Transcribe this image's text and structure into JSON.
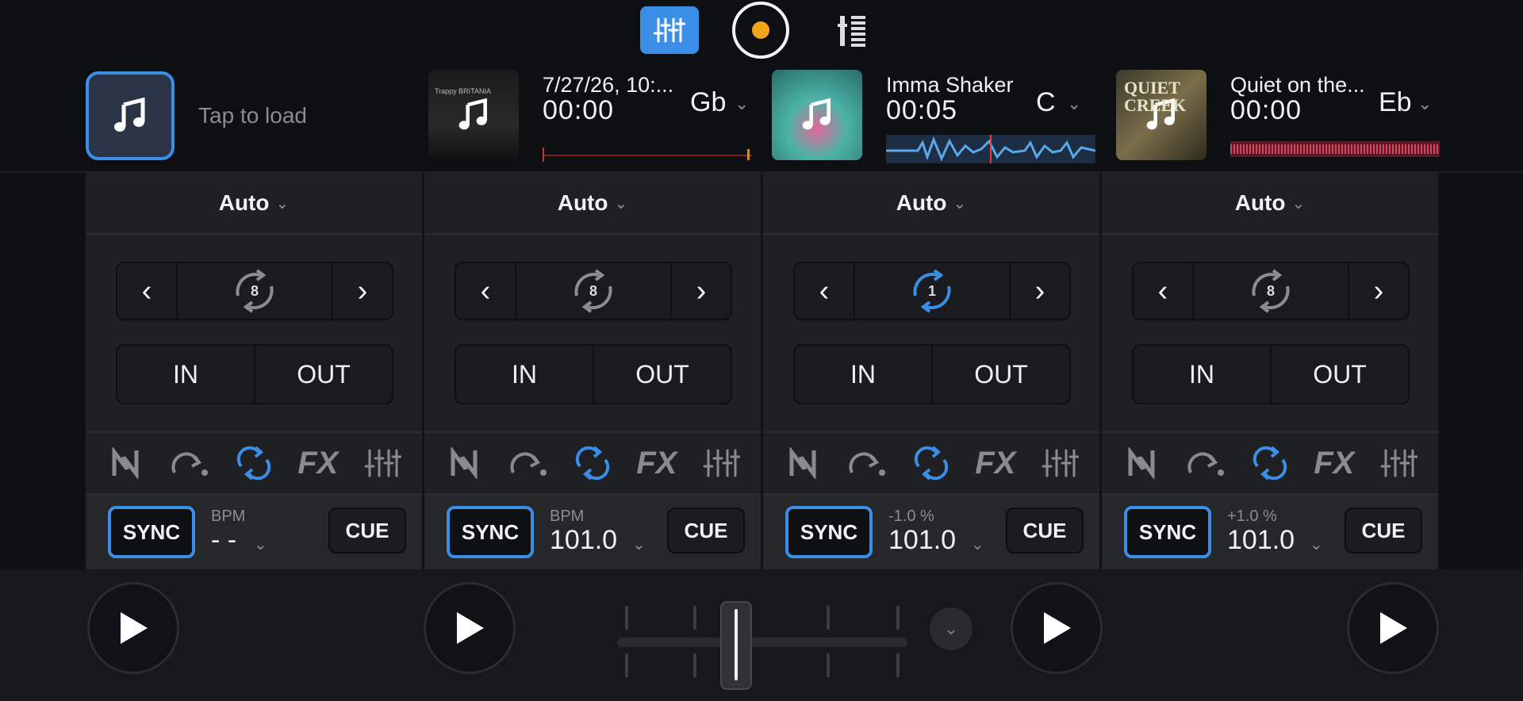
{
  "topbar": {
    "icons": [
      "mixer-icon",
      "record-icon",
      "levels-icon"
    ],
    "accent_color": "#3a8ee6",
    "record_color": "#f3a51a"
  },
  "load": {
    "text": "Tap to load"
  },
  "decks_header": [
    {
      "title": "7/27/26, 10:...",
      "time": "00:00",
      "key": "Gb",
      "waveform_color": "#c9362c"
    },
    {
      "title": "Imma Shaker",
      "time": "00:05",
      "key": "C",
      "waveform_color": "#3a8ee6"
    },
    {
      "title": "Quiet on the...",
      "time": "00:00",
      "key": "Eb",
      "waveform_color": "#d8455f"
    }
  ],
  "art_text": {
    "deck1_lines": "Trappy BRITANIA",
    "deck3_title": "QUIET CREEK"
  },
  "panels": [
    {
      "auto": "Auto",
      "loop": "8",
      "loop_active": false,
      "in": "IN",
      "out": "OUT",
      "fx": "FX",
      "sync": "SYNC",
      "bpm_label": "BPM",
      "bpm_value": "- -",
      "cue": "CUE"
    },
    {
      "auto": "Auto",
      "loop": "8",
      "loop_active": false,
      "in": "IN",
      "out": "OUT",
      "fx": "FX",
      "sync": "SYNC",
      "bpm_label": "BPM",
      "bpm_value": "101.0",
      "cue": "CUE"
    },
    {
      "auto": "Auto",
      "loop": "1",
      "loop_active": true,
      "in": "IN",
      "out": "OUT",
      "fx": "FX",
      "sync": "SYNC",
      "bpm_label": "-1.0 %",
      "bpm_value": "101.0",
      "cue": "CUE"
    },
    {
      "auto": "Auto",
      "loop": "8",
      "loop_active": false,
      "in": "IN",
      "out": "OUT",
      "fx": "FX",
      "sync": "SYNC",
      "bpm_label": "+1.0 %",
      "bpm_value": "101.0",
      "cue": "CUE"
    }
  ],
  "crossfader": {
    "position": 0.4
  }
}
